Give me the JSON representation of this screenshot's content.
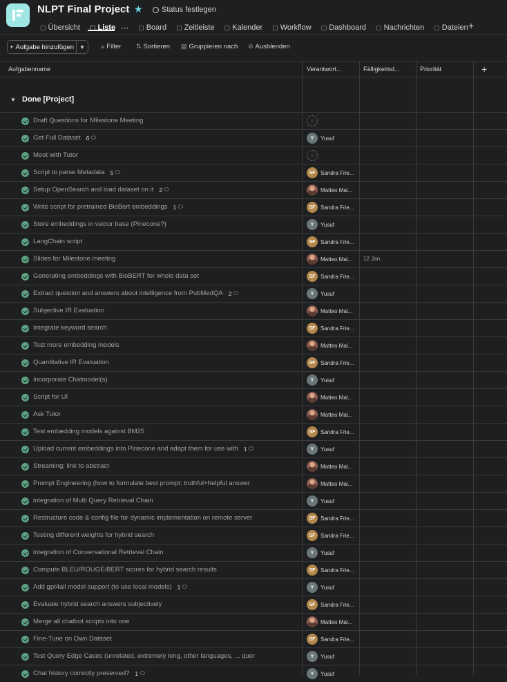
{
  "header": {
    "project_title": "NLPT Final Project",
    "status_label": "Status festlegen",
    "tabs": [
      {
        "label": "Übersicht",
        "icon": "overview-icon"
      },
      {
        "label": "Liste",
        "icon": "list-icon",
        "active": true
      },
      {
        "label": "Board",
        "icon": "board-icon"
      },
      {
        "label": "Zeitleiste",
        "icon": "timeline-icon"
      },
      {
        "label": "Kalender",
        "icon": "calendar-icon"
      },
      {
        "label": "Workflow",
        "icon": "workflow-icon"
      },
      {
        "label": "Dashboard",
        "icon": "dashboard-icon"
      },
      {
        "label": "Nachrichten",
        "icon": "messages-icon"
      },
      {
        "label": "Dateien",
        "icon": "files-icon"
      }
    ]
  },
  "toolbar": {
    "add_task": "Aufgabe hinzufügen",
    "filter": "Filter",
    "sort": "Sortieren",
    "group": "Gruppieren nach",
    "hide": "Ausblenden"
  },
  "columns": {
    "task_name": "Aufgabenname",
    "assignee": "Verantwort...",
    "due_date": "Fälligkeitsd...",
    "priority": "Priorität"
  },
  "section": {
    "title": "Done [Project]"
  },
  "colors": {
    "accent_check": "#5da283",
    "logo_bg": "#9ee7e3",
    "star": "#6fd6e5"
  },
  "tasks": [
    {
      "name": "Draft Questions for Milestone Meeting",
      "comments": "",
      "assignee": "",
      "initials": "",
      "due": ""
    },
    {
      "name": "Get Full Dataset",
      "comments": "6",
      "assignee": "Yusuf",
      "initials": "Y",
      "due": ""
    },
    {
      "name": "Meet with Tutor",
      "comments": "",
      "assignee": "",
      "initials": "",
      "due": ""
    },
    {
      "name": "Script to parse Metadata",
      "comments": "5",
      "assignee": "Sandra Frie...",
      "initials": "SF",
      "due": ""
    },
    {
      "name": "Setup OpenSearch and load dataset on it",
      "comments": "2",
      "assignee": "Matteo Mal...",
      "initials": "MM",
      "due": ""
    },
    {
      "name": "Write script for pretrained BioBert embeddings",
      "comments": "1",
      "assignee": "Sandra Frie...",
      "initials": "SF",
      "due": ""
    },
    {
      "name": "Store embeddings in vector base (Pinecone?)",
      "comments": "",
      "assignee": "Yusuf",
      "initials": "Y",
      "due": ""
    },
    {
      "name": "LangChain script",
      "comments": "",
      "assignee": "Sandra Frie...",
      "initials": "SF",
      "due": ""
    },
    {
      "name": "Slides for Milestone meeting",
      "comments": "",
      "assignee": "Matteo Mal...",
      "initials": "MM",
      "due": "12 Jan."
    },
    {
      "name": "Generating embeddings with BioBERT for whole data set",
      "comments": "",
      "assignee": "Sandra Frie...",
      "initials": "SF",
      "due": ""
    },
    {
      "name": "Extract question and answers about intelligence from PubMedQA",
      "comments": "2",
      "assignee": "Yusuf",
      "initials": "Y",
      "due": ""
    },
    {
      "name": "Subjective IR Evaluation",
      "comments": "",
      "assignee": "Matteo Mal...",
      "initials": "MM",
      "due": ""
    },
    {
      "name": "Integrate keyword search",
      "comments": "",
      "assignee": "Sandra Frie...",
      "initials": "SF",
      "due": ""
    },
    {
      "name": "Test more embedding models",
      "comments": "",
      "assignee": "Matteo Mal...",
      "initials": "MM",
      "due": ""
    },
    {
      "name": "Quantitative IR Evaluation",
      "comments": "",
      "assignee": "Sandra Frie...",
      "initials": "SF",
      "due": ""
    },
    {
      "name": "Incorporate Chatmodel(s)",
      "comments": "",
      "assignee": "Yusuf",
      "initials": "Y",
      "due": ""
    },
    {
      "name": "Script for UI",
      "comments": "",
      "assignee": "Matteo Mal...",
      "initials": "MM",
      "due": ""
    },
    {
      "name": "Ask Tutor",
      "comments": "",
      "assignee": "Matteo Mal...",
      "initials": "MM",
      "due": ""
    },
    {
      "name": "Test embedding models against BM25",
      "comments": "",
      "assignee": "Sandra Frie...",
      "initials": "SF",
      "due": ""
    },
    {
      "name": "Upload current embeddings into Pinecone and adapt them for use with",
      "comments": "1",
      "assignee": "Yusuf",
      "initials": "Y",
      "due": ""
    },
    {
      "name": "Streaming: link to abstract",
      "comments": "",
      "assignee": "Matteo Mal...",
      "initials": "MM",
      "due": ""
    },
    {
      "name": "Prompt Engineering (how to formulate best prompt: truthful+helpful answer",
      "comments": "",
      "assignee": "Matteo Mal...",
      "initials": "MM",
      "due": ""
    },
    {
      "name": "integration of Multi Query Retrieval Chain",
      "comments": "",
      "assignee": "Yusuf",
      "initials": "Y",
      "due": ""
    },
    {
      "name": "Restructure code & config file for dynamic implementation on remote server",
      "comments": "",
      "assignee": "Sandra Frie...",
      "initials": "SF",
      "due": ""
    },
    {
      "name": "Testing different weights for hybrid search",
      "comments": "",
      "assignee": "Sandra Frie...",
      "initials": "SF",
      "due": ""
    },
    {
      "name": "integration of Conversational Retrieval Chain",
      "comments": "",
      "assignee": "Yusuf",
      "initials": "Y",
      "due": ""
    },
    {
      "name": "Compute BLEU/ROUGE/BERT scores for hybrid search results",
      "comments": "",
      "assignee": "Sandra Frie...",
      "initials": "SF",
      "due": ""
    },
    {
      "name": "Add gpt4all model support (to use local models)",
      "comments": "1",
      "assignee": "Yusuf",
      "initials": "Y",
      "due": ""
    },
    {
      "name": "Evaluate hybrid search answers subjectively",
      "comments": "",
      "assignee": "Sandra Frie...",
      "initials": "SF",
      "due": ""
    },
    {
      "name": "Merge all chatbot scripts into one",
      "comments": "",
      "assignee": "Matteo Mal...",
      "initials": "MM",
      "due": ""
    },
    {
      "name": "Fine-Tune on Own Dataset",
      "comments": "",
      "assignee": "Sandra Frie...",
      "initials": "SF",
      "due": ""
    },
    {
      "name": "Test Query Edge Cases (unrelated, extremely long, other languages, ... quer",
      "comments": "",
      "assignee": "Yusuf",
      "initials": "Y",
      "due": ""
    },
    {
      "name": "Chat history correctly preserved?",
      "comments": "1",
      "assignee": "Yusuf",
      "initials": "Y",
      "due": ""
    }
  ]
}
